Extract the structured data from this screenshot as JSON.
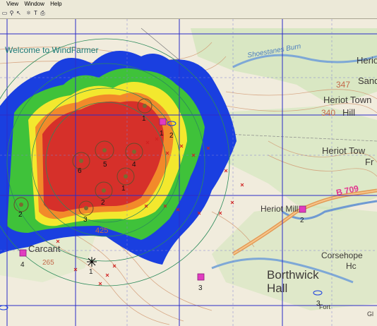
{
  "menu": {
    "view": "View",
    "window": "Window",
    "help": "Help"
  },
  "toolbar": {
    "icons": [
      "select-icon",
      "zoom-icon",
      "pointer-icon",
      "tree-icon",
      "text-icon",
      "print-icon"
    ]
  },
  "map": {
    "welcome": "Welcome to WindFarmer",
    "places": {
      "heriot_top": "Heriot",
      "sand": "Sand",
      "heriot_town_1": "Heriot Town",
      "hill": "Hill",
      "heriot_town_2": "Heriot Tow",
      "fr": "Fr",
      "heriot_mill": "Heriot Mill",
      "carcant": "Carcant",
      "borthwick": "Borthwick",
      "hall": "Hall",
      "corsehope": "Corsehope",
      "hc": "Hc",
      "fort": "Fort",
      "gl": "Gl",
      "burn": "Shoestanes Burn"
    },
    "heights": {
      "h347": "347",
      "h340": "340",
      "h425": "425",
      "h265": "265"
    },
    "road": "B 709",
    "turbine_labels": [
      "1",
      "1",
      "2",
      "4",
      "5",
      "6",
      "1",
      "2",
      "3",
      "2"
    ],
    "house_labels": [
      "2",
      "4",
      "3",
      "2",
      "3",
      "1"
    ],
    "colors": {
      "red": "#d6302a",
      "orange": "#f28a2a",
      "yellow": "#f3e82e",
      "green": "#3fc23a",
      "blue": "#1a3fe0",
      "grid": "#2c2cc8",
      "ring": "#2b8a5a",
      "house": "#e03cc0"
    }
  }
}
